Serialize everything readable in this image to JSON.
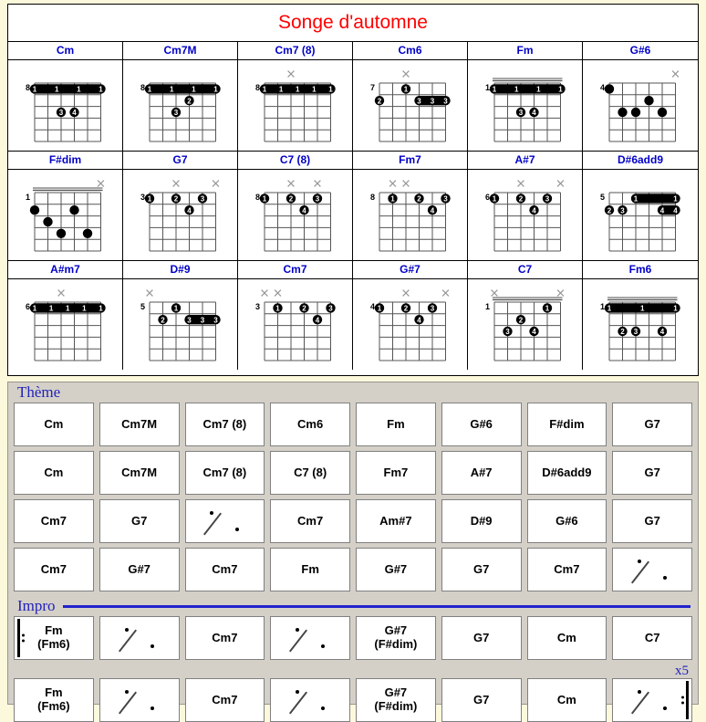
{
  "title": "Songe d'automne",
  "colors": {
    "title": "#ff0000",
    "chord_name": "#0000c8",
    "section_label": "#2222bb",
    "page_bg": "#fbf8dc",
    "panel_bg": "#d4d0c8"
  },
  "chord_diagrams": [
    {
      "name": "Cm",
      "start_fret": "8",
      "show_fret_label": true,
      "nut": false,
      "markers": [
        "",
        "",
        "",
        "",
        "",
        ""
      ],
      "barres": [
        {
          "fret": 1,
          "from": 0,
          "to": 5,
          "label": "1",
          "extra_labels": [
            "1",
            "1",
            "1"
          ]
        }
      ],
      "dots": [
        {
          "string": 2,
          "fret": 3,
          "finger": "3"
        },
        {
          "string": 3,
          "fret": 3,
          "finger": "4"
        }
      ]
    },
    {
      "name": "Cm7M",
      "start_fret": "8",
      "show_fret_label": true,
      "nut": false,
      "markers": [
        "",
        "",
        "",
        "",
        "",
        ""
      ],
      "barres": [
        {
          "fret": 1,
          "from": 0,
          "to": 5,
          "label": "1",
          "extra_labels": [
            "1",
            "1",
            "1"
          ]
        }
      ],
      "dots": [
        {
          "string": 3,
          "fret": 2,
          "finger": "2"
        },
        {
          "string": 2,
          "fret": 3,
          "finger": "3"
        }
      ]
    },
    {
      "name": "Cm7 (8)",
      "start_fret": "8",
      "show_fret_label": true,
      "nut": false,
      "markers": [
        "",
        "",
        "x",
        "",
        "",
        ""
      ],
      "barres": [
        {
          "fret": 1,
          "from": 0,
          "to": 5,
          "label": "1",
          "extra_labels": [
            "1",
            "1",
            "1",
            "1"
          ]
        }
      ],
      "dots": []
    },
    {
      "name": "Cm6",
      "start_fret": "7",
      "show_fret_label": true,
      "nut": false,
      "markers": [
        "",
        "",
        "x",
        "",
        "",
        ""
      ],
      "barres": [
        {
          "fret": 2,
          "from": 3,
          "to": 5,
          "label": "3",
          "extra_labels": [
            "3",
            "3"
          ]
        }
      ],
      "dots": [
        {
          "string": 2,
          "fret": 1,
          "finger": "1"
        },
        {
          "string": 0,
          "fret": 2,
          "finger": "2"
        }
      ]
    },
    {
      "name": "Fm",
      "start_fret": "1",
      "show_fret_label": true,
      "nut": true,
      "markers": [
        "",
        "",
        "",
        "",
        "",
        ""
      ],
      "barres": [
        {
          "fret": 1,
          "from": 0,
          "to": 5,
          "label": "1",
          "extra_labels": [
            "1",
            "1",
            "1"
          ]
        }
      ],
      "dots": [
        {
          "string": 2,
          "fret": 3,
          "finger": "3"
        },
        {
          "string": 3,
          "fret": 3,
          "finger": "4"
        }
      ]
    },
    {
      "name": "G#6",
      "start_fret": "4",
      "show_fret_label": true,
      "nut": false,
      "markers": [
        "",
        "",
        "",
        "",
        "",
        "x"
      ],
      "barres": [],
      "dots": [
        {
          "string": 0,
          "fret": 1,
          "finger": ""
        },
        {
          "string": 3,
          "fret": 2,
          "finger": ""
        },
        {
          "string": 1,
          "fret": 3,
          "finger": ""
        },
        {
          "string": 2,
          "fret": 3,
          "finger": ""
        },
        {
          "string": 4,
          "fret": 3,
          "finger": ""
        }
      ]
    },
    {
      "name": "F#dim",
      "start_fret": "1",
      "show_fret_label": true,
      "nut": true,
      "markers": [
        "",
        "",
        "",
        "",
        "",
        "x"
      ],
      "barres": [],
      "dots": [
        {
          "string": 0,
          "fret": 2,
          "finger": ""
        },
        {
          "string": 3,
          "fret": 2,
          "finger": ""
        },
        {
          "string": 1,
          "fret": 3,
          "finger": ""
        },
        {
          "string": 2,
          "fret": 4,
          "finger": ""
        },
        {
          "string": 4,
          "fret": 4,
          "finger": ""
        }
      ]
    },
    {
      "name": "G7",
      "start_fret": "3",
      "show_fret_label": true,
      "nut": false,
      "markers": [
        "",
        "",
        "x",
        "",
        "",
        "x"
      ],
      "barres": [],
      "dots": [
        {
          "string": 0,
          "fret": 1,
          "finger": "1"
        },
        {
          "string": 2,
          "fret": 1,
          "finger": "2"
        },
        {
          "string": 4,
          "fret": 1,
          "finger": "3"
        },
        {
          "string": 3,
          "fret": 2,
          "finger": "4"
        }
      ]
    },
    {
      "name": "C7 (8)",
      "start_fret": "8",
      "show_fret_label": true,
      "nut": false,
      "markers": [
        "",
        "",
        "x",
        "",
        "x",
        ""
      ],
      "barres": [],
      "dots": [
        {
          "string": 0,
          "fret": 1,
          "finger": "1"
        },
        {
          "string": 2,
          "fret": 1,
          "finger": "2"
        },
        {
          "string": 4,
          "fret": 1,
          "finger": "3"
        },
        {
          "string": 3,
          "fret": 2,
          "finger": "4"
        }
      ]
    },
    {
      "name": "Fm7",
      "start_fret": "8",
      "show_fret_label": true,
      "nut": false,
      "markers": [
        "",
        "x",
        "x",
        "",
        "",
        ""
      ],
      "barres": [],
      "dots": [
        {
          "string": 1,
          "fret": 1,
          "finger": "1"
        },
        {
          "string": 3,
          "fret": 1,
          "finger": "2"
        },
        {
          "string": 5,
          "fret": 1,
          "finger": "3"
        },
        {
          "string": 4,
          "fret": 2,
          "finger": "4"
        }
      ]
    },
    {
      "name": "A#7",
      "start_fret": "6",
      "show_fret_label": true,
      "nut": false,
      "markers": [
        "",
        "",
        "x",
        "",
        "",
        "x"
      ],
      "barres": [],
      "dots": [
        {
          "string": 0,
          "fret": 1,
          "finger": "1"
        },
        {
          "string": 2,
          "fret": 1,
          "finger": "2"
        },
        {
          "string": 4,
          "fret": 1,
          "finger": "3"
        },
        {
          "string": 3,
          "fret": 2,
          "finger": "4"
        }
      ]
    },
    {
      "name": "D#6add9",
      "start_fret": "5",
      "show_fret_label": true,
      "nut": false,
      "markers": [
        "",
        "",
        "",
        "",
        "",
        ""
      ],
      "barres": [
        {
          "fret": 1,
          "from": 2,
          "to": 5,
          "label": "1",
          "extra_labels": [
            "1"
          ]
        },
        {
          "fret": 2,
          "from": 4,
          "to": 5,
          "label": "4",
          "extra_labels": [
            "4"
          ]
        }
      ],
      "dots": [
        {
          "string": 0,
          "fret": 2,
          "finger": "2"
        },
        {
          "string": 1,
          "fret": 2,
          "finger": "3"
        }
      ]
    },
    {
      "name": "A#m7",
      "start_fret": "6",
      "show_fret_label": true,
      "nut": false,
      "markers": [
        "",
        "",
        "x",
        "",
        "",
        ""
      ],
      "barres": [
        {
          "fret": 1,
          "from": 0,
          "to": 5,
          "label": "1",
          "extra_labels": [
            "1",
            "1",
            "1",
            "1"
          ]
        }
      ],
      "dots": []
    },
    {
      "name": "D#9",
      "start_fret": "5",
      "show_fret_label": true,
      "nut": false,
      "markers": [
        "x",
        "",
        "",
        "",
        "",
        ""
      ],
      "barres": [
        {
          "fret": 2,
          "from": 3,
          "to": 5,
          "label": "3",
          "extra_labels": [
            "3",
            "3"
          ]
        }
      ],
      "dots": [
        {
          "string": 2,
          "fret": 1,
          "finger": "1"
        },
        {
          "string": 1,
          "fret": 2,
          "finger": "2"
        }
      ]
    },
    {
      "name": "Cm7",
      "start_fret": "3",
      "show_fret_label": true,
      "nut": false,
      "markers": [
        "x",
        "x",
        "",
        "",
        "",
        ""
      ],
      "barres": [],
      "dots": [
        {
          "string": 1,
          "fret": 1,
          "finger": "1"
        },
        {
          "string": 3,
          "fret": 1,
          "finger": "2"
        },
        {
          "string": 5,
          "fret": 1,
          "finger": "3"
        },
        {
          "string": 4,
          "fret": 2,
          "finger": "4"
        }
      ]
    },
    {
      "name": "G#7",
      "start_fret": "4",
      "show_fret_label": true,
      "nut": false,
      "markers": [
        "",
        "",
        "x",
        "",
        "",
        "x"
      ],
      "barres": [],
      "dots": [
        {
          "string": 0,
          "fret": 1,
          "finger": "1"
        },
        {
          "string": 2,
          "fret": 1,
          "finger": "2"
        },
        {
          "string": 4,
          "fret": 1,
          "finger": "3"
        },
        {
          "string": 3,
          "fret": 2,
          "finger": "4"
        }
      ]
    },
    {
      "name": "C7",
      "start_fret": "1",
      "show_fret_label": true,
      "nut": true,
      "markers": [
        "x",
        "",
        "",
        "",
        "",
        "x"
      ],
      "barres": [],
      "dots": [
        {
          "string": 4,
          "fret": 1,
          "finger": "1"
        },
        {
          "string": 2,
          "fret": 2,
          "finger": "2"
        },
        {
          "string": 1,
          "fret": 3,
          "finger": "3"
        },
        {
          "string": 3,
          "fret": 3,
          "finger": "4"
        }
      ]
    },
    {
      "name": "Fm6",
      "start_fret": "1",
      "show_fret_label": true,
      "nut": true,
      "markers": [
        "",
        "",
        "",
        "",
        "",
        ""
      ],
      "barres": [
        {
          "fret": 1,
          "from": 0,
          "to": 5,
          "label": "1",
          "extra_labels": [
            "1",
            "1"
          ]
        }
      ],
      "dots": [
        {
          "string": 1,
          "fret": 3,
          "finger": "2"
        },
        {
          "string": 2,
          "fret": 3,
          "finger": "3"
        },
        {
          "string": 4,
          "fret": 3,
          "finger": "4"
        }
      ]
    }
  ],
  "progression": {
    "theme": {
      "label": "Thème",
      "rows": [
        [
          {
            "text": "Cm"
          },
          {
            "text": "Cm7M"
          },
          {
            "text": "Cm7 (8)"
          },
          {
            "text": "Cm6"
          },
          {
            "text": "Fm"
          },
          {
            "text": "G#6"
          },
          {
            "text": "F#dim"
          },
          {
            "text": "G7"
          }
        ],
        [
          {
            "text": "Cm"
          },
          {
            "text": "Cm7M"
          },
          {
            "text": "Cm7 (8)"
          },
          {
            "text": "C7 (8)"
          },
          {
            "text": "Fm7"
          },
          {
            "text": "A#7"
          },
          {
            "text": "D#6add9"
          },
          {
            "text": "G7"
          }
        ],
        [
          {
            "text": "Cm7"
          },
          {
            "text": "G7"
          },
          {
            "text": "",
            "repeat": true
          },
          {
            "text": "Cm7"
          },
          {
            "text": "Am#7"
          },
          {
            "text": "D#9"
          },
          {
            "text": "G#6"
          },
          {
            "text": "G7"
          }
        ],
        [
          {
            "text": "Cm7"
          },
          {
            "text": "G#7"
          },
          {
            "text": "Cm7"
          },
          {
            "text": "Fm"
          },
          {
            "text": "G#7"
          },
          {
            "text": "G7"
          },
          {
            "text": "Cm7"
          },
          {
            "text": "",
            "repeat": true
          }
        ]
      ]
    },
    "impro": {
      "label": "Impro",
      "repeat_count": "x5",
      "rows": [
        [
          {
            "text": "Fm",
            "sub": "(Fm6)",
            "repeat_start": true
          },
          {
            "text": "",
            "repeat": true
          },
          {
            "text": "Cm7"
          },
          {
            "text": "",
            "repeat": true
          },
          {
            "text": "G#7",
            "sub": "(F#dim)"
          },
          {
            "text": "G7"
          },
          {
            "text": "Cm"
          },
          {
            "text": "C7"
          }
        ],
        [
          {
            "text": "Fm",
            "sub": "(Fm6)"
          },
          {
            "text": "",
            "repeat": true
          },
          {
            "text": "Cm7"
          },
          {
            "text": "",
            "repeat": true
          },
          {
            "text": "G#7",
            "sub": "(F#dim)"
          },
          {
            "text": "G7"
          },
          {
            "text": "Cm"
          },
          {
            "text": "",
            "repeat": true,
            "repeat_end": true
          }
        ]
      ]
    }
  }
}
